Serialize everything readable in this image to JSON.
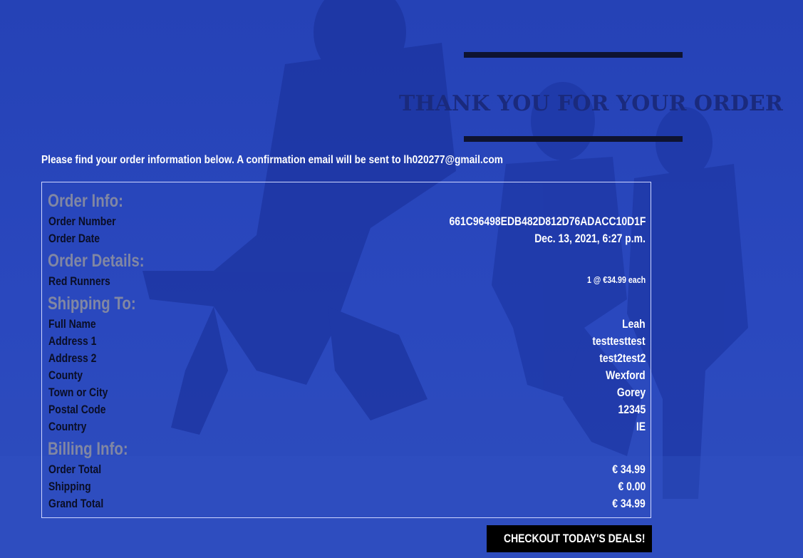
{
  "page": {
    "title": "THANK YOU FOR YOUR ORDER",
    "intro": "Please find your order information below. A confirmation email will be sent to lh020277@gmail.com"
  },
  "order_info": {
    "heading": "Order Info:",
    "rows": [
      {
        "label": "Order Number",
        "value": "661C96498EDB482D812D76ADACC10D1F"
      },
      {
        "label": "Order Date",
        "value": "Dec. 13, 2021, 6:27 p.m."
      }
    ]
  },
  "order_details": {
    "heading": "Order Details:",
    "items": [
      {
        "label": "Red Runners",
        "value": "1 @ €34.99 each"
      }
    ]
  },
  "shipping": {
    "heading": "Shipping To:",
    "rows": [
      {
        "label": "Full Name",
        "value": "Leah"
      },
      {
        "label": "Address 1",
        "value": "testtesttest"
      },
      {
        "label": "Address 2",
        "value": "test2test2"
      },
      {
        "label": "County",
        "value": "Wexford"
      },
      {
        "label": "Town or City",
        "value": "Gorey"
      },
      {
        "label": "Postal Code",
        "value": "12345"
      },
      {
        "label": "Country",
        "value": "IE"
      }
    ]
  },
  "billing": {
    "heading": "Billing Info:",
    "rows": [
      {
        "label": "Order Total",
        "value": "€ 34.99"
      },
      {
        "label": "Shipping",
        "value": "€ 0.00"
      },
      {
        "label": "Grand Total",
        "value": "€ 34.99"
      }
    ]
  },
  "cta": {
    "label": "CHECKOUT TODAY'S DEALS!",
    "icon": "shopping-bags-icon"
  },
  "colors": {
    "background": "#2440b4",
    "title": "#1a2a7d",
    "heading": "#8187a3",
    "label": "#0a0e26",
    "value": "#ffffff",
    "button": "#000000"
  }
}
